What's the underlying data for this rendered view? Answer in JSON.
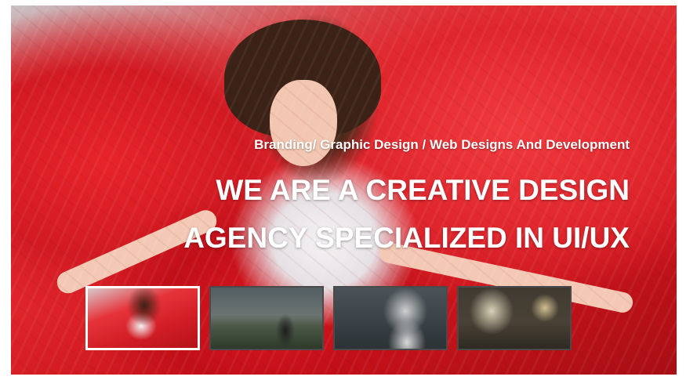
{
  "slider": {
    "subtitle": "Branding/ Graphic Design / Web Designs And Development",
    "headline_line1": "WE ARE A CREATIVE DESIGN",
    "headline_line2": "AGENCY SPECIALIZED IN UI/UX",
    "active_slide": 1,
    "thumbnails": [
      {
        "subject": "woman in red dress",
        "active": true
      },
      {
        "subject": "man at sunset",
        "active": false
      },
      {
        "subject": "woman with fur hat",
        "active": false
      },
      {
        "subject": "blonde woman with lamp",
        "active": false
      }
    ],
    "colors": {
      "accent_red": "#e3282d",
      "text": "#ffffff",
      "thumb_border_active": "#ffffff",
      "thumb_border": "#4a4a4a"
    }
  }
}
